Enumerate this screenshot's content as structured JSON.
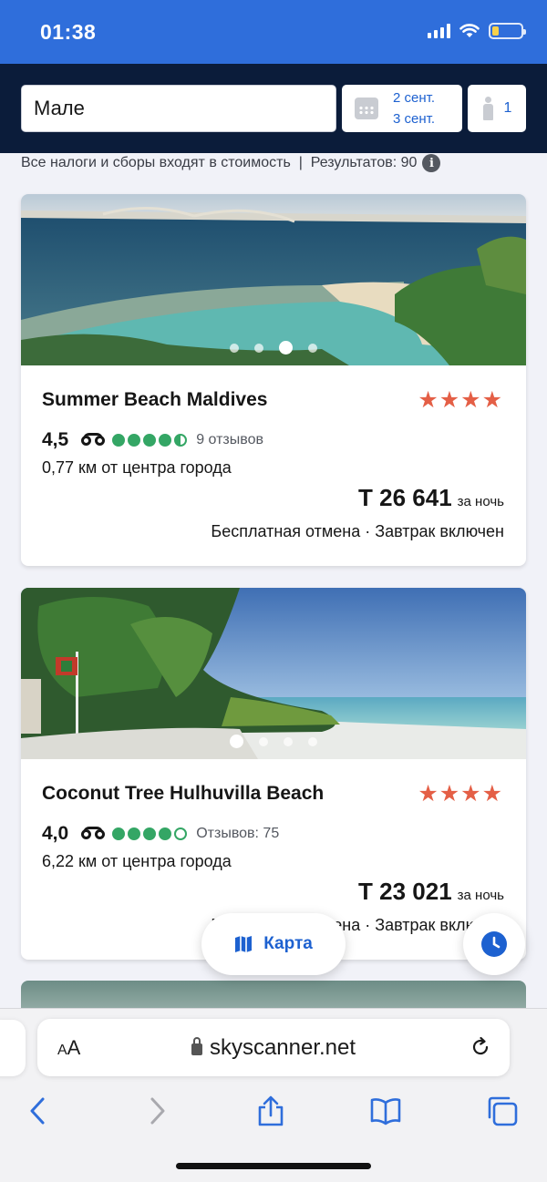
{
  "status_bar": {
    "time": "01:38",
    "battery_level": 0.15
  },
  "search": {
    "destination": "Мале",
    "date_from": "2 сент.",
    "date_to": "3 сент.",
    "guests": "1"
  },
  "results_info": "Все налоги и сборы входят в стоимость  |  Результатов: 90",
  "hotels": [
    {
      "name": "Summer Beach Maldives",
      "stars": "★★★★",
      "rating": "4,5",
      "bubbles": [
        1,
        1,
        1,
        1,
        0.5
      ],
      "reviews": "9 отзывов",
      "distance": "0,77 км от центра города",
      "price": "Т 26 641",
      "per_night": "за ночь",
      "features": "Бесплатная отмена · Завтрак включен",
      "image_dots": 4,
      "active_dot": 3
    },
    {
      "name": "Coconut Tree Hulhuvilla Beach",
      "stars": "★★★★",
      "rating": "4,0",
      "bubbles": [
        1,
        1,
        1,
        1,
        0
      ],
      "reviews": "Отзывов: 75",
      "distance": "6,22 км от центра города",
      "price": "Т 23 021",
      "per_night": "за ночь",
      "features": "Бесплатная отмена · Завтрак включен",
      "image_dots": 4,
      "active_dot": 1
    }
  ],
  "map_button": {
    "label": "Карта"
  },
  "browser": {
    "aa_label_small": "A",
    "aa_label_large": "A",
    "url": "skyscanner.net"
  },
  "colors": {
    "status_bar": "#2f6edb",
    "header": "#0b1c3a",
    "accent": "#1d61d0",
    "stars": "#e45f46",
    "tripadvisor": "#34a665"
  }
}
